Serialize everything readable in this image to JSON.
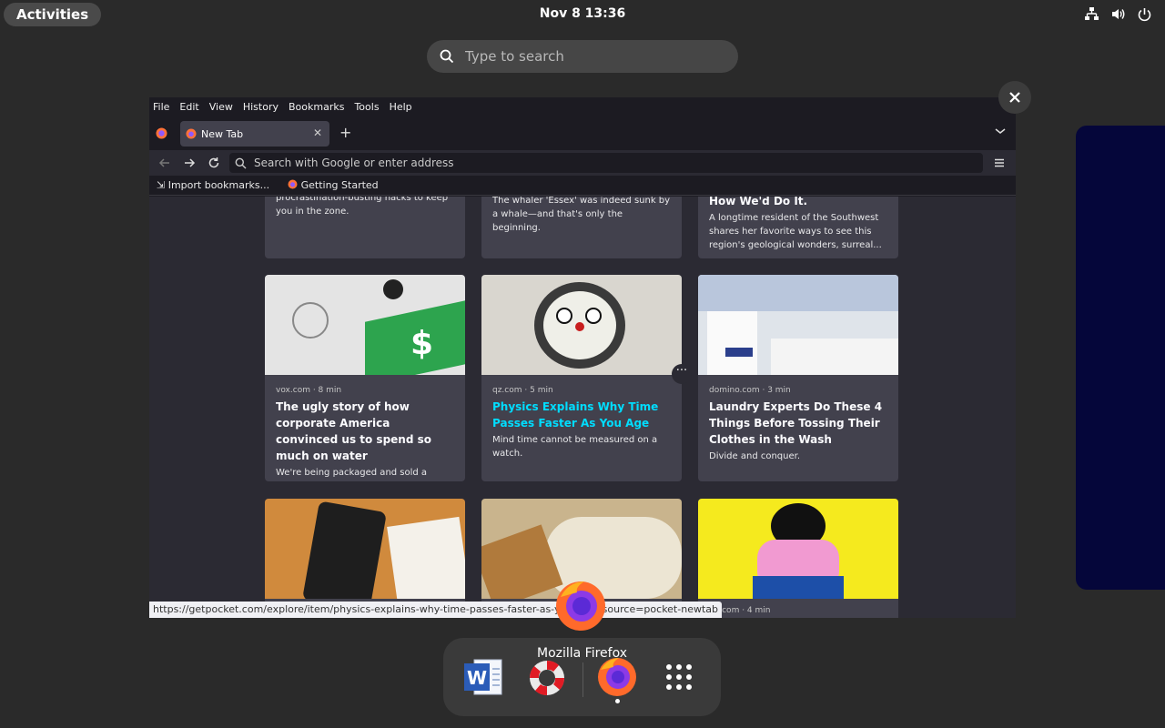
{
  "topbar": {
    "activities_label": "Activities",
    "clock": "Nov 8  13:36"
  },
  "search": {
    "placeholder": "Type to search"
  },
  "firefox": {
    "menu": [
      "File",
      "Edit",
      "View",
      "History",
      "Bookmarks",
      "Tools",
      "Help"
    ],
    "tab_title": "New Tab",
    "url_placeholder": "Search with Google or enter address",
    "bookmarks": {
      "import": "Import bookmarks...",
      "getting_started": "Getting Started"
    },
    "cards_top": [
      {
        "desc": "procrastination-busting hacks to keep you in the zone."
      },
      {
        "desc": "The whaler 'Essex' was indeed sunk by a whale—and that's only the beginning."
      },
      {
        "title": "How We'd Do It.",
        "desc": "A longtime resident of the Southwest shares her favorite ways to see this region's geological wonders, surreal..."
      }
    ],
    "cards_mid": [
      {
        "source": "vox.com · 8 min",
        "title": "The ugly story of how corporate America convinced us to spend so much on water",
        "desc": "We're being packaged and sold a bottle/can/box of lies on water."
      },
      {
        "source": "qz.com · 5 min",
        "title": "Physics Explains Why Time Passes Faster As You Age",
        "desc": "Mind time cannot be measured on a watch."
      },
      {
        "source": "domino.com · 3 min",
        "title": "Laundry Experts Do These 4 Things Before Tossing Their Clothes in the Wash",
        "desc": "Divide and conquer."
      }
    ],
    "card_bottom_partial_source": "ed.com · 4 min",
    "status_url": "https://getpocket.com/explore/item/physics-explains-why-time-passes-faster-as-y",
    "status_url_tail": "m_source=pocket-newtab"
  },
  "dock": {
    "hover_label": "Mozilla Firefox"
  },
  "colors": {
    "highlight_title": "#00ddff",
    "workspace2": "#05063a"
  }
}
